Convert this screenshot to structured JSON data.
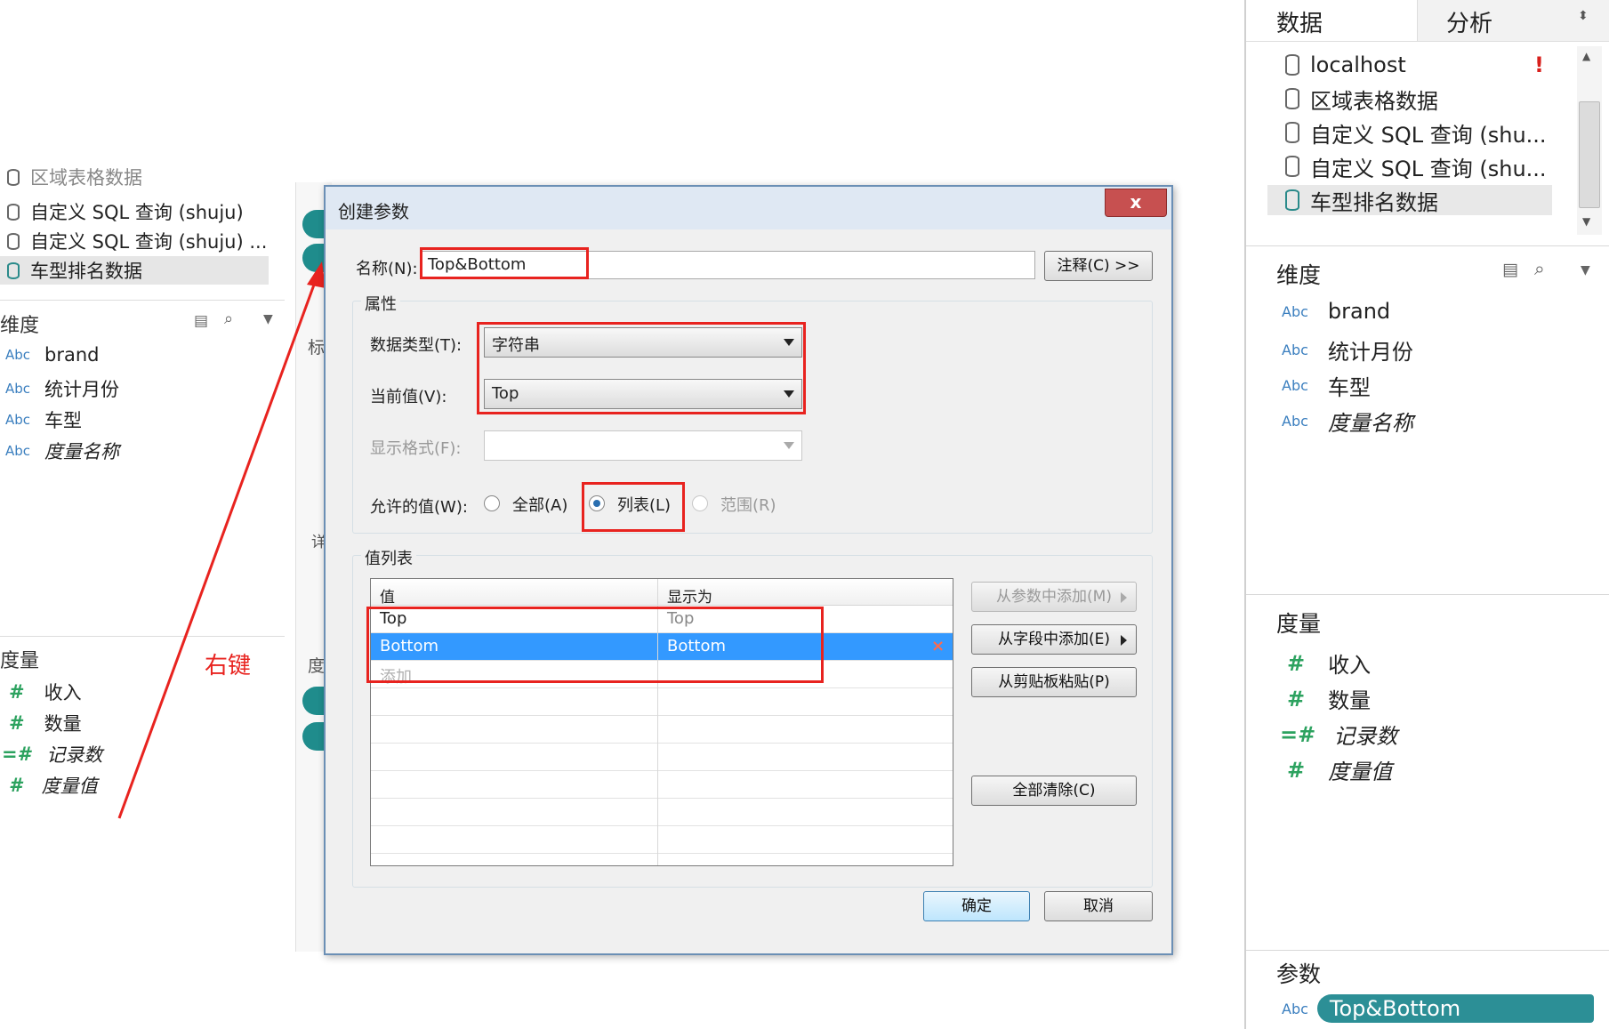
{
  "left_panel": {
    "datasources": [
      {
        "label": "区域表格数据"
      },
      {
        "label": "自定义 SQL 查询 (shuju)"
      },
      {
        "label": "自定义 SQL 查询 (shuju) ..."
      },
      {
        "label": "车型排名数据"
      }
    ],
    "dimensions_title": "维度",
    "dimensions": [
      {
        "type": "Abc",
        "label": "brand"
      },
      {
        "type": "Abc",
        "label": "统计月份"
      },
      {
        "type": "Abc",
        "label": "车型"
      },
      {
        "type": "Abc",
        "label": "度量名称"
      }
    ],
    "measures_title": "度量",
    "measures": [
      {
        "type": "#",
        "label": "收入"
      },
      {
        "type": "#",
        "label": "数量"
      },
      {
        "type": "=#",
        "label": "记录数"
      },
      {
        "type": "#",
        "label": "度量值"
      }
    ],
    "middle_labels": [
      "标",
      "详",
      "度"
    ]
  },
  "annotation": {
    "text": "右键",
    "color": "#e8231f"
  },
  "right_panel": {
    "tabs": {
      "data": "数据",
      "analysis": "分析"
    },
    "datasources": [
      {
        "label": "localhost",
        "warning": "!"
      },
      {
        "label": "区域表格数据"
      },
      {
        "label": "自定义 SQL 查询 (shu..."
      },
      {
        "label": "自定义 SQL 查询 (shu..."
      },
      {
        "label": "车型排名数据"
      }
    ],
    "dimensions_title": "维度",
    "dimensions": [
      {
        "type": "Abc",
        "label": "brand"
      },
      {
        "type": "Abc",
        "label": "统计月份"
      },
      {
        "type": "Abc",
        "label": "车型"
      },
      {
        "type": "Abc",
        "label": "度量名称"
      }
    ],
    "measures_title": "度量",
    "measures": [
      {
        "type": "#",
        "label": "收入"
      },
      {
        "type": "#",
        "label": "数量"
      },
      {
        "type": "=#",
        "label": "记录数"
      },
      {
        "type": "#",
        "label": "度量值"
      }
    ],
    "parameters_title": "参数",
    "parameter": {
      "type": "Abc",
      "label": "Top&Bottom"
    }
  },
  "dialog": {
    "title": "创建参数",
    "close": "x",
    "name_label": "名称(N):",
    "name_value": "Top&Bottom",
    "comment_button": "注释(C) >>",
    "properties_title": "属性",
    "data_type_label": "数据类型(T):",
    "data_type_value": "字符串",
    "current_value_label": "当前值(V):",
    "current_value": "Top",
    "display_format_label": "显示格式(F):",
    "display_format_value": "",
    "allowed_label": "允许的值(W):",
    "allowed_options": {
      "all": "全部(A)",
      "list": "列表(L)",
      "range": "范围(R)"
    },
    "allowed_selected": "list",
    "value_list_title": "值列表",
    "table": {
      "headers": {
        "value": "值",
        "display": "显示为"
      },
      "rows": [
        {
          "value": "Top",
          "display": "Top"
        },
        {
          "value": "Bottom",
          "display": "Bottom"
        }
      ],
      "add_placeholder": "添加",
      "delete_mark": "×"
    },
    "buttons": {
      "add_from_param": "从参数中添加(M)",
      "add_from_field": "从字段中添加(E)",
      "paste": "从剪贴板粘贴(P)",
      "clear_all": "全部清除(C)",
      "ok": "确定",
      "cancel": "取消"
    }
  }
}
